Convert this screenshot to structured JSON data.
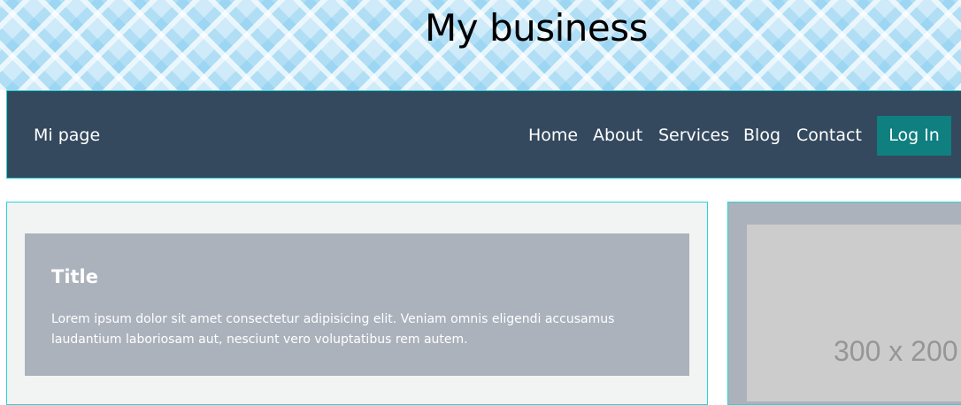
{
  "header": {
    "title": "My business"
  },
  "navbar": {
    "brand": "Mi page",
    "links": [
      "Home",
      "About",
      "Services",
      "Blog",
      "Contact"
    ],
    "login_label": "Log In"
  },
  "main": {
    "title": "Title",
    "text": "Lorem ipsum dolor sit amet consectetur adipisicing elit. Veniam omnis eligendi accusamus laudantium laboriosam aut, nesciunt vero voluptatibus rem autem."
  },
  "sidebar": {
    "image_placeholder": "300 x 200"
  },
  "colors": {
    "navbar_bg": "#34495e",
    "login_bg": "#0f7f80",
    "content_box_bg": "#abb2bc",
    "card_bg": "#f2f4f4",
    "border_accent": "#26d6d6"
  }
}
